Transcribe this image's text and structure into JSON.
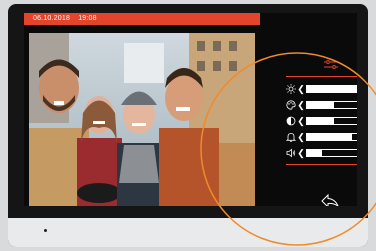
{
  "status_bar": {
    "date": "06.10.2018",
    "time": "19:08"
  },
  "photo": {
    "description_icon": "camera-feed-image"
  },
  "settings": {
    "icon": "equalizer-icon",
    "rows": [
      {
        "key": "brightness",
        "icon": "sun-icon",
        "level": 0.95
      },
      {
        "key": "color",
        "icon": "palette-icon",
        "level": 0.45
      },
      {
        "key": "contrast",
        "icon": "contrast-icon",
        "level": 0.45
      },
      {
        "key": "ringtone-volume",
        "icon": "bell-icon",
        "level": 0.75
      },
      {
        "key": "speaker-volume",
        "icon": "speaker-icon",
        "level": 0.25
      }
    ],
    "back_icon": "back-arrow-icon"
  },
  "colors": {
    "accent": "#e2452b",
    "highlight": "#f08a2a"
  }
}
